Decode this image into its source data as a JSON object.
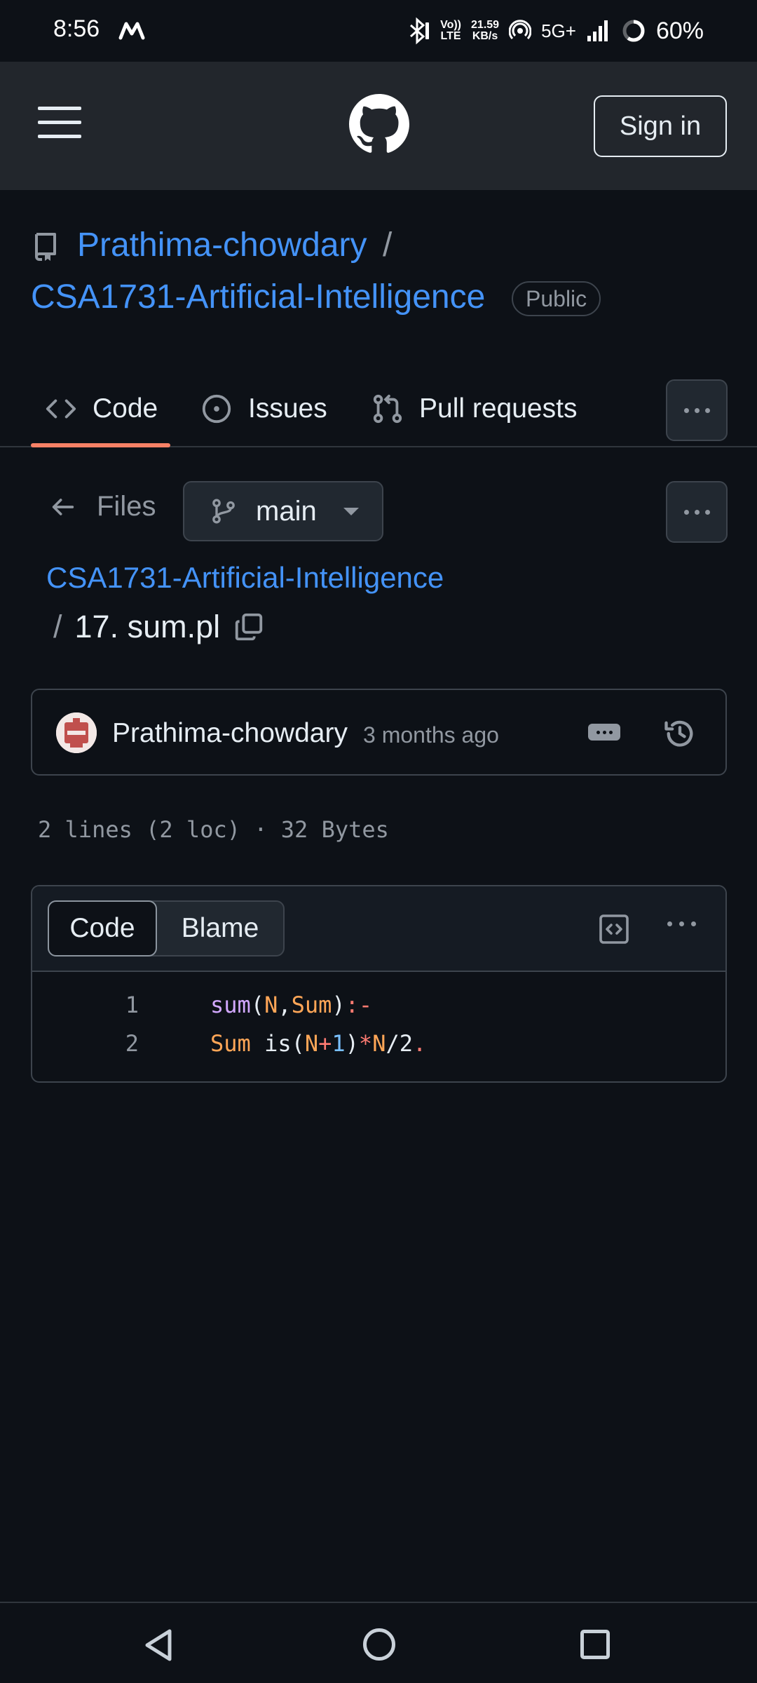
{
  "status_bar": {
    "time": "8:56",
    "net_speed_top": "21.59",
    "net_speed_bottom": "KB/s",
    "volte_top": "Vo))",
    "volte_bottom": "LTE",
    "network": "5G+",
    "battery": "60%"
  },
  "header": {
    "sign_in_label": "Sign in"
  },
  "repo": {
    "owner": "Prathima-chowdary",
    "separator": "/",
    "name": "CSA1731-Artificial-Intelligence",
    "visibility": "Public"
  },
  "tabs": [
    {
      "label": "Code",
      "icon": "code-icon",
      "active": true
    },
    {
      "label": "Issues",
      "icon": "issue-opened-icon"
    },
    {
      "label": "Pull requests",
      "icon": "git-pull-request-icon"
    }
  ],
  "files_nav": {
    "back_label": "Files",
    "branch": "main"
  },
  "breadcrumb": {
    "repo_link": "CSA1731-Artificial-Intelligence",
    "separator": "/",
    "file_name": "17. sum.pl"
  },
  "commit": {
    "author": "Prathima-chowdary",
    "time_ago": "3 months ago"
  },
  "file_info": "2 lines (2 loc) · 32 Bytes",
  "viewer": {
    "code_tab": "Code",
    "blame_tab": "Blame",
    "lines": [
      {
        "number": "1",
        "text": "sum(N,Sum):-"
      },
      {
        "number": "2",
        "text": "Sum is(N+1)*N/2."
      }
    ]
  },
  "colors": {
    "background": "#0d1117",
    "header": "#22262c",
    "link": "#4493f8",
    "tab_underline": "#f78166",
    "muted": "#9198a1"
  }
}
